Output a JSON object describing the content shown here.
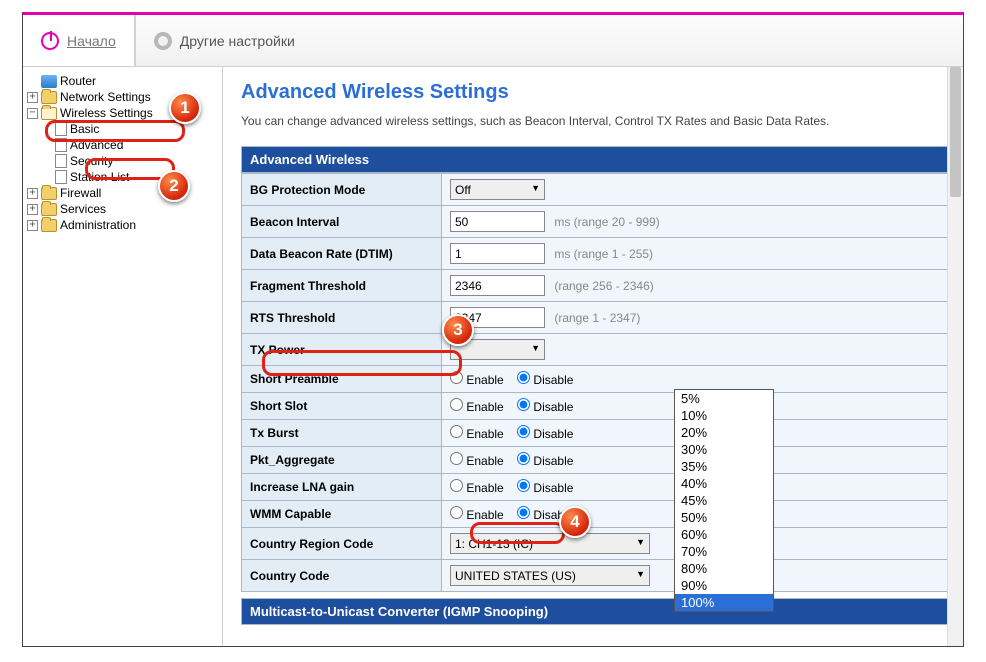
{
  "tabs": {
    "home": "Начало",
    "other": "Другие настройки"
  },
  "tree": {
    "router": "Router",
    "network": "Network Settings",
    "wireless": "Wireless Settings",
    "basic": "Basic",
    "advanced": "Advanced",
    "security": "Security",
    "station": "Station List",
    "firewall": "Firewall",
    "services": "Services",
    "admin": "Administration"
  },
  "page": {
    "title": "Advanced Wireless Settings",
    "desc": "You can change advanced wireless settings, such as Beacon Interval, Control TX Rates and Basic Data Rates.",
    "section1": "Advanced Wireless",
    "section2": "Multicast-to-Unicast Converter (IGMP Snooping)"
  },
  "rows": {
    "bg": {
      "label": "BG Protection Mode",
      "value": "Off"
    },
    "beacon": {
      "label": "Beacon Interval",
      "value": "50",
      "hint": "ms (range 20 - 999)"
    },
    "dtim": {
      "label": "Data Beacon Rate (DTIM)",
      "value": "1",
      "hint": "ms (range 1 - 255)"
    },
    "frag": {
      "label": "Fragment Threshold",
      "value": "2346",
      "hint": "(range 256 - 2346)"
    },
    "rts": {
      "label": "RTS Threshold",
      "value": "2347",
      "hint": "(range 1 - 2347)"
    },
    "tx": {
      "label": "TX Power"
    },
    "preamble": {
      "label": "Short Preamble",
      "enable": "Enable",
      "disable": "Disable"
    },
    "slot": {
      "label": "Short Slot",
      "enable": "Enable",
      "disable": "Disable"
    },
    "burst": {
      "label": "Tx Burst",
      "enable": "Enable",
      "disable": "Disable"
    },
    "pkt": {
      "label": "Pkt_Aggregate",
      "enable": "Enable",
      "disable": "Disable"
    },
    "lna": {
      "label": "Increase LNA gain",
      "enable": "Enable",
      "disable": "Disable"
    },
    "wmm": {
      "label": "WMM Capable",
      "enable": "Enable",
      "disable": "Disable"
    },
    "region": {
      "label": "Country Region Code",
      "value": "1: CH1-13 (IC)"
    },
    "country": {
      "label": "Country Code",
      "value": "UNITED STATES (US)"
    }
  },
  "tx_options": [
    "5%",
    "10%",
    "20%",
    "30%",
    "35%",
    "40%",
    "45%",
    "50%",
    "60%",
    "70%",
    "80%",
    "90%",
    "100%"
  ],
  "tx_selected": "100%",
  "badges": {
    "b1": "1",
    "b2": "2",
    "b3": "3",
    "b4": "4"
  }
}
